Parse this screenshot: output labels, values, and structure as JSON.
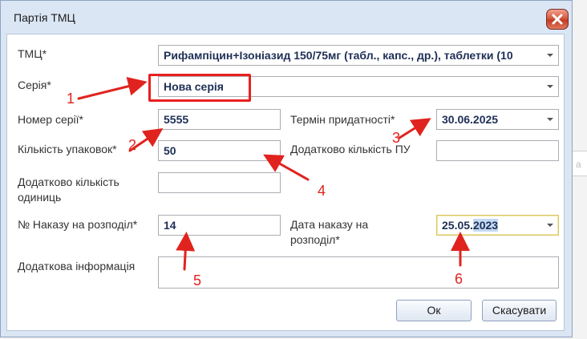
{
  "window": {
    "title": "Партія ТМЦ",
    "background_hint": "а"
  },
  "form": {
    "tmc": {
      "label": "ТМЦ*",
      "value": "Рифампіцин+Ізоніазид 150/75мг (табл., капс., др.), таблетки  (10"
    },
    "series": {
      "label": "Серія*",
      "value": "Нова серія"
    },
    "series_number": {
      "label": "Номер серії*",
      "value": "5555"
    },
    "expiry": {
      "label": "Термін придатності*",
      "value": "30.06.2025"
    },
    "packs": {
      "label": "Кількість упаковок*",
      "value": "50"
    },
    "extra_pu": {
      "label": "Додатково кількість ПУ",
      "value": ""
    },
    "extra_units": {
      "label_line1": "Додатково кількість",
      "label_line2": "одиниць",
      "value": ""
    },
    "order_no": {
      "label": "№ Наказу на розподіл*",
      "value": "14"
    },
    "order_date": {
      "label_line1": "Дата наказу на",
      "label_line2": "розподіл*",
      "value_prefix": "25.05.",
      "value_selected": "2023"
    },
    "extra_info": {
      "label": "Додаткова інформація",
      "value": ""
    }
  },
  "buttons": {
    "ok": "Ок",
    "cancel": "Скасувати"
  },
  "annotations": [
    "1",
    "2",
    "3",
    "4",
    "5",
    "6"
  ],
  "colors": {
    "annotation_red": "#e0231e",
    "field_text": "#1e2f55",
    "selection": "#c3d9f3",
    "dialog_frame": "#dbe6f4"
  }
}
